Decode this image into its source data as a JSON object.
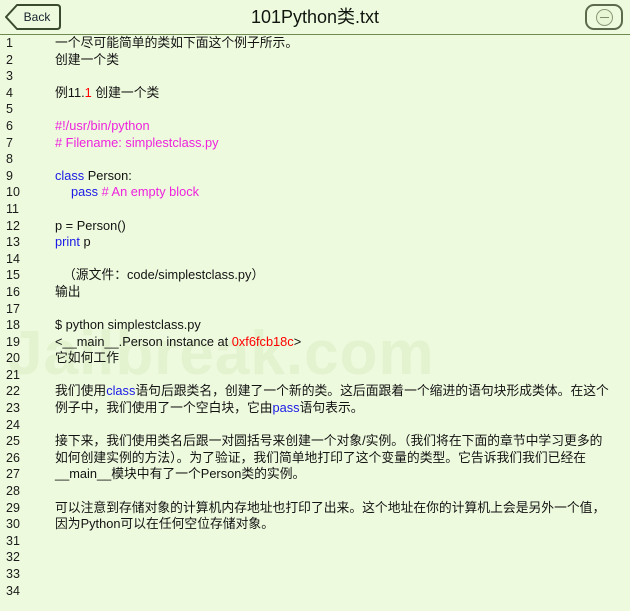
{
  "window": {
    "title": "101Python类.txt",
    "back_label": "Back",
    "minus_icon": "minus-circle-icon",
    "background_color": "#eefade"
  },
  "watermark": {
    "text": "Jailbreak.com",
    "color": "#e3f2cf"
  },
  "editor": {
    "colors": {
      "keyword": "#1a1ae6",
      "comment": "#ee22dd",
      "highlight": "#ff0000",
      "text": "#121212",
      "gutter": "#1a1a1a"
    },
    "lines": [
      {
        "n": "1",
        "segments": [
          {
            "t": "一个尽可能简单的类如下面这个例子所示。",
            "c": "plain"
          }
        ]
      },
      {
        "n": "2",
        "segments": [
          {
            "t": "创建一个类",
            "c": "plain"
          }
        ]
      },
      {
        "n": "3",
        "segments": []
      },
      {
        "n": "4",
        "segments": [
          {
            "t": "例11.",
            "c": "plain"
          },
          {
            "t": "1",
            "c": "red"
          },
          {
            "t": " 创建一个类",
            "c": "plain"
          }
        ]
      },
      {
        "n": "5",
        "segments": []
      },
      {
        "n": "6",
        "segments": [
          {
            "t": "#!/usr/bin/python",
            "c": "cmt"
          }
        ]
      },
      {
        "n": "7",
        "segments": [
          {
            "t": "# Filename: simplestclass.py",
            "c": "cmt"
          }
        ]
      },
      {
        "n": "8",
        "segments": []
      },
      {
        "n": "9",
        "segments": [
          {
            "t": "class",
            "c": "kw"
          },
          {
            "t": " Person:",
            "c": "plain"
          }
        ]
      },
      {
        "n": "10",
        "segments": [
          {
            "t": "pass",
            "c": "kw"
          },
          {
            "t": " ",
            "c": "plain"
          },
          {
            "t": "# An empty block",
            "c": "cmt"
          }
        ],
        "indent": "indent1"
      },
      {
        "n": "11",
        "segments": []
      },
      {
        "n": "12",
        "segments": [
          {
            "t": "p = Person()",
            "c": "plain"
          }
        ]
      },
      {
        "n": "13",
        "segments": [
          {
            "t": "print",
            "c": "kw"
          },
          {
            "t": " p",
            "c": "plain"
          }
        ]
      },
      {
        "n": "14",
        "segments": []
      },
      {
        "n": "15",
        "segments": [
          {
            "t": "（源文件：code/simplestclass.py）",
            "c": "plain"
          }
        ],
        "indent": "indent2"
      },
      {
        "n": "16",
        "segments": [
          {
            "t": "输出",
            "c": "plain"
          }
        ]
      },
      {
        "n": "17",
        "segments": []
      },
      {
        "n": "18",
        "segments": [
          {
            "t": "$ python simplestclass.py",
            "c": "plain"
          }
        ]
      },
      {
        "n": "19",
        "segments": [
          {
            "t": "<__main__.Person instance at ",
            "c": "plain"
          },
          {
            "t": "0xf6fcb18c",
            "c": "red"
          },
          {
            "t": ">",
            "c": "plain"
          }
        ]
      },
      {
        "n": "20",
        "segments": [
          {
            "t": "它如何工作",
            "c": "plain"
          }
        ]
      },
      {
        "n": "21",
        "segments": []
      },
      {
        "n": "22",
        "segments": [
          {
            "t": "我们使用",
            "c": "plain"
          },
          {
            "t": "class",
            "c": "kw"
          },
          {
            "t": "语句后跟类名，创建了一个新的类。这后面跟着一个缩进的语句块形成类体。在这个",
            "c": "plain"
          }
        ]
      },
      {
        "n": "23",
        "segments": [
          {
            "t": "例子中，我们使用了一个空白块，它由",
            "c": "plain"
          },
          {
            "t": "pass",
            "c": "kw"
          },
          {
            "t": "语句表示。",
            "c": "plain"
          }
        ]
      },
      {
        "n": "24",
        "segments": []
      },
      {
        "n": "25",
        "segments": [
          {
            "t": "接下来，我们使用类名后跟一对圆括号来创建一个对象/实例。（我们将在下面的章节中学习更多的",
            "c": "plain"
          }
        ]
      },
      {
        "n": "26",
        "segments": [
          {
            "t": "如何创建实例的方法）。为了验证，我们简单地打印了这个变量的类型。它告诉我们我们已经在",
            "c": "plain"
          }
        ]
      },
      {
        "n": "27",
        "segments": [
          {
            "t": "__main__模块中有了一个Person类的实例。",
            "c": "plain"
          }
        ]
      },
      {
        "n": "28",
        "segments": []
      },
      {
        "n": "29",
        "segments": [
          {
            "t": "可以注意到存储对象的计算机内存地址也打印了出来。这个地址在你的计算机上会是另外一个值，",
            "c": "plain"
          }
        ]
      },
      {
        "n": "30",
        "segments": [
          {
            "t": "因为Python可以在任何空位存储对象。",
            "c": "plain"
          }
        ]
      },
      {
        "n": "31",
        "segments": []
      },
      {
        "n": "32",
        "segments": []
      },
      {
        "n": "33",
        "segments": []
      },
      {
        "n": "34",
        "segments": []
      }
    ]
  }
}
